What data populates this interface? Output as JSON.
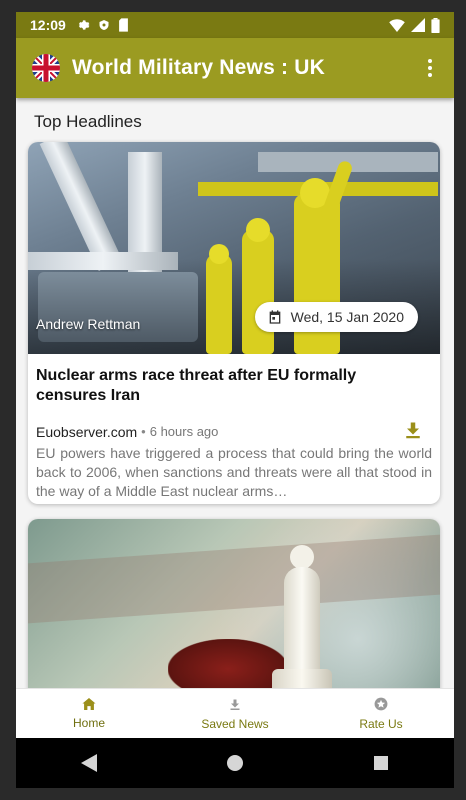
{
  "status_bar": {
    "time": "12:09"
  },
  "app_bar": {
    "title": "World Military News : UK",
    "menu_icon": "more-vert-icon"
  },
  "section": {
    "title": "Top Headlines"
  },
  "articles": [
    {
      "author": "Andrew Rettman",
      "date": "Wed, 15 Jan 2020",
      "headline": "Nuclear arms race threat after EU formally censures Iran",
      "source": "Euobserver.com",
      "separator": "•",
      "time_ago": "6 hours ago",
      "description": "EU powers have triggered a process that could bring the world back to 2006, when sanctions and threats were all that stood in the way of a Middle East nuclear arms…"
    },
    {
      "date": ""
    }
  ],
  "bottom_nav": [
    {
      "label": "Home",
      "icon": "home-icon",
      "active": true
    },
    {
      "label": "Saved News",
      "icon": "download-icon",
      "active": false
    },
    {
      "label": "Rate Us",
      "icon": "star-circle-icon",
      "active": false
    }
  ],
  "colors": {
    "status_bar": "#7a7a12",
    "app_bar": "#9b9b21",
    "accent": "#9b8f1a",
    "background": "#f4f4f4"
  }
}
